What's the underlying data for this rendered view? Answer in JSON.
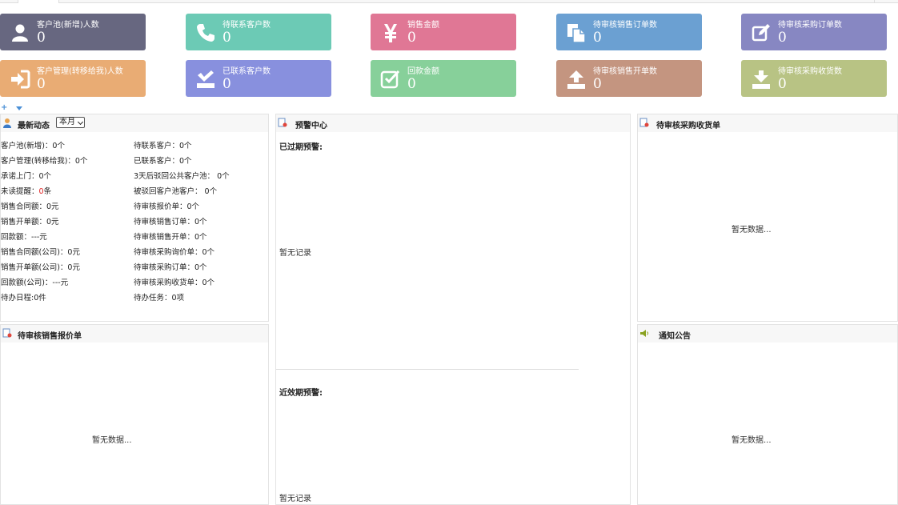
{
  "cards": [
    {
      "title": "客户池(新增)人数",
      "value": "0",
      "icon": "user-icon",
      "color": "#676780"
    },
    {
      "title": "待联系客户数",
      "value": "0",
      "icon": "phone-icon",
      "color": "#6ccab5"
    },
    {
      "title": "销售金额",
      "value": "0",
      "icon": "yen-icon",
      "color": "#e07795"
    },
    {
      "title": "待审核销售订单数",
      "value": "0",
      "icon": "documents-icon",
      "color": "#6ba0d2"
    },
    {
      "title": "待审核采购订单数",
      "value": "0",
      "icon": "edit-icon",
      "color": "#8787c2"
    },
    {
      "title": "客户管理(转移给我)人数",
      "value": "0",
      "icon": "sign-in-icon",
      "color": "#e9ac74"
    },
    {
      "title": "已联系客户数",
      "value": "0",
      "icon": "checklist-icon",
      "color": "#8890de"
    },
    {
      "title": "回款金额",
      "value": "0",
      "icon": "check-square-icon",
      "color": "#87d09a"
    },
    {
      "title": "待审核销售开单数",
      "value": "0",
      "icon": "upload-icon",
      "color": "#c49580"
    },
    {
      "title": "待审核采购收货数",
      "value": "0",
      "icon": "download-icon",
      "color": "#b8c384"
    }
  ],
  "dynamics": {
    "title": "最新动态",
    "period": "本月",
    "icon": "user-panel-icon",
    "left": [
      {
        "label": "客户池(新增)：",
        "value": "0个"
      },
      {
        "label": "客户管理(转移给我)：",
        "value": "0个"
      },
      {
        "label": "承诺上门：",
        "value": "0个"
      },
      {
        "label": "未读提醒：",
        "value": "0",
        "suffix": "条"
      },
      {
        "label": "销售合同额：",
        "value": "0元"
      },
      {
        "label": "销售开单额：",
        "value": "0元"
      },
      {
        "label": "回款额：",
        "value": "---元"
      },
      {
        "label": "销售合同额(公司)：",
        "value": "0元"
      },
      {
        "label": "销售开单额(公司)：",
        "value": "0元"
      },
      {
        "label": "回款额(公司)：",
        "value": "---元"
      },
      {
        "label": "待办日程:",
        "value": "0件"
      }
    ],
    "right": [
      {
        "label": "待联系客户：",
        "value": "0个"
      },
      {
        "label": "已联系客户：",
        "value": "0个"
      },
      {
        "label": "3天后驳回公共客户池：",
        "value": " 0个"
      },
      {
        "label": "被驳回客户池客户：",
        "value": " 0个"
      },
      {
        "label": "待审核报价单：",
        "value": "0个"
      },
      {
        "label": "待审核销售订单：",
        "value": "0个"
      },
      {
        "label": "待审核销售开单：",
        "value": "0个"
      },
      {
        "label": "待审核采购询价单：",
        "value": "0个"
      },
      {
        "label": "待审核采购订单：",
        "value": "0个"
      },
      {
        "label": "待审核采购收货单：",
        "value": "0个"
      },
      {
        "label": "待办任务：",
        "value": "0项"
      }
    ]
  },
  "warning": {
    "title": "预警中心",
    "expired_label": "已过期预警:",
    "expired_empty": "暂无记录",
    "near_label": "近效期预警:",
    "near_empty": "暂无记录"
  },
  "purchase_receipt": {
    "title": "待审核采购收货单",
    "empty": "暂无数据..."
  },
  "sales_quote": {
    "title": "待审核销售报价单",
    "empty": "暂无数据..."
  },
  "notice": {
    "title": "通知公告",
    "empty": "暂无数据..."
  }
}
